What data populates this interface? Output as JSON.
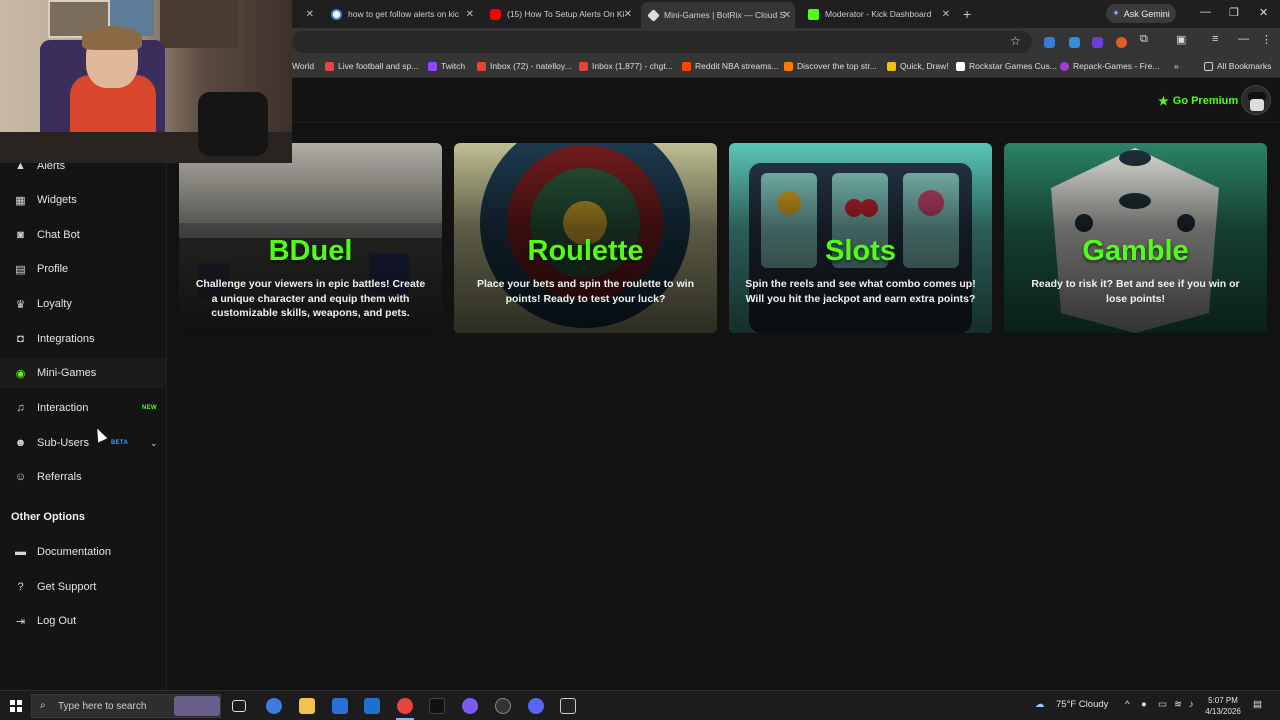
{
  "browser": {
    "tabs": [
      {
        "title": "how to get follow alerts on kic",
        "favicon": "google-icon",
        "color": "#4285f4"
      },
      {
        "title": "(15) How To Setup Alerts On Ki",
        "favicon": "youtube-icon",
        "color": "#ff0000"
      },
      {
        "title": "Mini-Games | BotRix — Cloud S",
        "favicon": "botrix-icon",
        "color": "#dddddd",
        "active": true
      },
      {
        "title": "Moderator - Kick Dashboard",
        "favicon": "kick-icon",
        "color": "#53fc18"
      }
    ],
    "ask_gemini": "Ask Gemini",
    "bookmarks": [
      {
        "label": "World",
        "color": "#888888"
      },
      {
        "label": "Live football and sp...",
        "color": "#e64545"
      },
      {
        "label": "Twitch",
        "color": "#9146ff"
      },
      {
        "label": "Inbox (72) - natelloy...",
        "color": "#ea4335"
      },
      {
        "label": "Inbox (1,877) - chgt...",
        "color": "#ea4335"
      },
      {
        "label": "Reddit NBA streams...",
        "color": "#ff4500"
      },
      {
        "label": "Discover the top str...",
        "color": "#ff7a00"
      },
      {
        "label": "Quick, Draw!",
        "color": "#f4c20d"
      },
      {
        "label": "Rockstar Games Cus...",
        "color": "#ffffff"
      },
      {
        "label": "Repack-Games - Fre...",
        "color": "#a43bd6"
      }
    ],
    "all_bookmarks": "All Bookmarks"
  },
  "header": {
    "premium_label": "Go Premium",
    "accent": "#53fc18"
  },
  "sidebar": {
    "items": [
      {
        "label": "Alerts",
        "icon": "alert-icon"
      },
      {
        "label": "Widgets",
        "icon": "widgets-icon"
      },
      {
        "label": "Chat Bot",
        "icon": "robot-icon"
      },
      {
        "label": "Profile",
        "icon": "profile-icon"
      },
      {
        "label": "Loyalty",
        "icon": "trophy-icon"
      },
      {
        "label": "Integrations",
        "icon": "integrations-icon"
      },
      {
        "label": "Mini-Games",
        "icon": "gamepad-icon",
        "active": true
      },
      {
        "label": "Interaction",
        "icon": "music-icon",
        "badge": "NEW"
      },
      {
        "label": "Sub-Users",
        "icon": "users-icon",
        "badge": "BETA"
      },
      {
        "label": "Referrals",
        "icon": "referrals-icon"
      }
    ],
    "other_title": "Other Options",
    "other_items": [
      {
        "label": "Documentation",
        "icon": "docs-icon"
      },
      {
        "label": "Get Support",
        "icon": "help-icon"
      },
      {
        "label": "Log Out",
        "icon": "logout-icon"
      }
    ]
  },
  "games": [
    {
      "title": "BDuel",
      "description": "Challenge your viewers in epic battles! Create a unique character and equip them with customizable skills, weapons, and pets."
    },
    {
      "title": "Roulette",
      "description": "Place your bets and spin the roulette to win points! Ready to test your luck?"
    },
    {
      "title": "Slots",
      "description": "Spin the reels and see what combo comes up! Will you hit the jackpot and earn extra points?"
    },
    {
      "title": "Gamble",
      "description": "Ready to risk it? Bet and see if you win or lose points!"
    }
  ],
  "taskbar": {
    "search_placeholder": "Type here to search",
    "weather": "75°F  Cloudy",
    "time": "5:07 PM",
    "date": "4/13/2026"
  }
}
